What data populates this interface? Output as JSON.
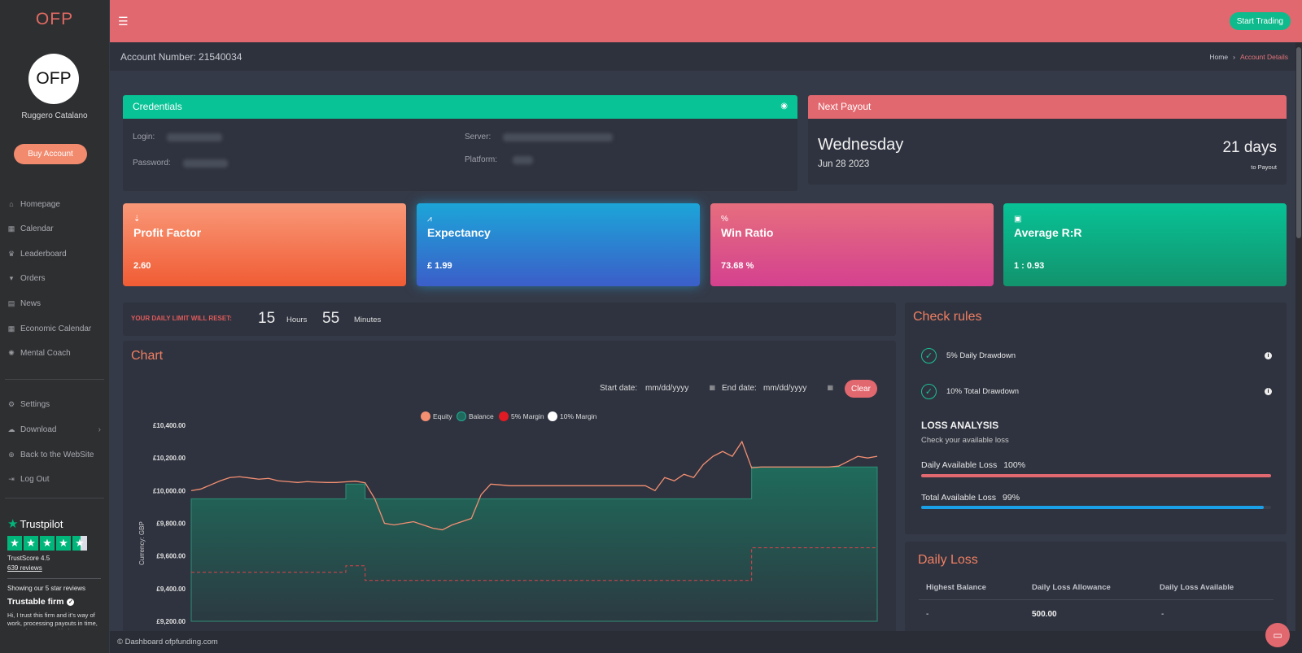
{
  "sidebar": {
    "logo": "OFP",
    "avatar_text": "OFP",
    "user_name": "Ruggero Catalano",
    "buy_label": "Buy Account",
    "items": [
      {
        "label": "Homepage",
        "icon": "home-icon"
      },
      {
        "label": "Calendar",
        "icon": "calendar-icon"
      },
      {
        "label": "Leaderboard",
        "icon": "trophy-icon"
      },
      {
        "label": "Orders",
        "icon": "cart-icon"
      },
      {
        "label": "News",
        "icon": "news-icon"
      },
      {
        "label": "Economic Calendar",
        "icon": "calendar-icon"
      },
      {
        "label": "Mental Coach",
        "icon": "brain-icon"
      }
    ],
    "bottom_items": [
      {
        "label": "Settings",
        "icon": "user-cog-icon"
      },
      {
        "label": "Download",
        "icon": "cloud-download-icon"
      },
      {
        "label": "Back to the WebSite",
        "icon": "globe-icon"
      },
      {
        "label": "Log Out",
        "icon": "logout-icon"
      }
    ],
    "trustpilot": {
      "name": "Trustpilot",
      "score": "TrustScore 4.5",
      "reviews": "639 reviews",
      "showing": "Showing our 5 star reviews",
      "review_title": "Trustable firm",
      "review_text": "Hi, I trust this firm and it's way of work, processing payouts in time, server is great, and help"
    }
  },
  "topbar": {
    "start_label": "Start Trading"
  },
  "subbar": {
    "account": "Account Number: 21540034",
    "crumb_home": "Home",
    "crumb_current": "Account Details"
  },
  "credentials": {
    "title": "Credentials",
    "login_label": "Login:",
    "password_label": "Password:",
    "server_label": "Server:",
    "platform_label": "Platform:"
  },
  "payout": {
    "title": "Next Payout",
    "day": "Wednesday",
    "date": "Jun 28 2023",
    "days": "21 days",
    "to": "to Payout"
  },
  "stats": [
    {
      "title": "Profit Factor",
      "value": "2.60",
      "icon": "arrow-down-icon"
    },
    {
      "title": "Expectancy",
      "value": "£ 1.99",
      "icon": "chart-line-icon"
    },
    {
      "title": "Win Ratio",
      "value": "73.68 %",
      "icon": "percent-icon"
    },
    {
      "title": "Average R:R",
      "value": "1 : 0.93",
      "icon": "money-bill-icon"
    }
  ],
  "reset": {
    "label": "YOUR DAILY LIMIT WILL RESET:",
    "hours": "15",
    "hours_label": "Hours",
    "minutes": "55",
    "minutes_label": "Minutes"
  },
  "chart_section": {
    "title": "Chart",
    "start_label": "Start date:",
    "end_label": "End date:",
    "date_placeholder": "mm/dd/yyyy",
    "clear_label": "Clear"
  },
  "chart_data": {
    "type": "line",
    "ylabel": "Currency: GBP",
    "ylim": [
      9200,
      10400
    ],
    "ticks": [
      "£10,400.00",
      "£10,200.00",
      "£10,000.00",
      "£9,800.00",
      "£9,600.00",
      "£9,400.00",
      "£9,200.00"
    ],
    "tick_values": [
      10400,
      10200,
      10000,
      9800,
      9600,
      9400,
      9200
    ],
    "legend": [
      "Equity",
      "Balance",
      "5% Margin",
      "10% Margin"
    ],
    "colors": {
      "equity": "#f48f72",
      "balance": "#1f6a5c",
      "margin5": "#e01b24",
      "margin10": "#ffffff"
    },
    "series": [
      {
        "name": "Equity",
        "values": [
          10000,
          10010,
          10035,
          10060,
          10080,
          10085,
          10078,
          10070,
          10075,
          10060,
          10055,
          10050,
          10055,
          10052,
          10050,
          10050,
          10054,
          10058,
          10048,
          9950,
          9800,
          9790,
          9800,
          9810,
          9790,
          9770,
          9760,
          9790,
          9810,
          9830,
          9975,
          10040,
          10035,
          10030,
          10030,
          10030,
          10030,
          10030,
          10030,
          10030,
          10030,
          10030,
          10030,
          10030,
          10030,
          10030,
          10030,
          10030,
          10000,
          10080,
          10060,
          10100,
          10080,
          10160,
          10210,
          10240,
          10210,
          10300,
          10140,
          10145,
          10145,
          10145,
          10145,
          10145,
          10145,
          10145,
          10145,
          10150,
          10180,
          10210,
          10200,
          10210
        ]
      },
      {
        "name": "Balance",
        "values": [
          9950,
          9950,
          9950,
          9950,
          9950,
          9950,
          9950,
          9950,
          9950,
          9950,
          9950,
          9950,
          9950,
          9950,
          9950,
          9950,
          10040,
          10040,
          9950,
          9950,
          9950,
          9950,
          9950,
          9950,
          9950,
          9950,
          9950,
          9950,
          9950,
          9950,
          9950,
          9950,
          9950,
          9950,
          9950,
          9950,
          9950,
          9950,
          9950,
          9950,
          9950,
          9950,
          9950,
          9950,
          9950,
          9950,
          9950,
          9950,
          9950,
          9950,
          9950,
          9950,
          9950,
          9950,
          9950,
          9950,
          9950,
          9950,
          10145,
          10145,
          10145,
          10145,
          10145,
          10145,
          10145,
          10145,
          10145,
          10145,
          10145,
          10145,
          10145,
          10145
        ]
      }
    ],
    "margin5": [
      9500,
      9500,
      9500,
      9500,
      9500,
      9500,
      9500,
      9500,
      9500,
      9500,
      9500,
      9500,
      9500,
      9500,
      9500,
      9500,
      9540,
      9540,
      9450,
      9450,
      9450,
      9450,
      9450,
      9450,
      9450,
      9450,
      9450,
      9450,
      9450,
      9450,
      9450,
      9450,
      9450,
      9450,
      9450,
      9450,
      9450,
      9450,
      9450,
      9450,
      9450,
      9450,
      9450,
      9450,
      9450,
      9450,
      9450,
      9450,
      9450,
      9450,
      9450,
      9450,
      9450,
      9450,
      9450,
      9450,
      9450,
      9450,
      9650,
      9650,
      9650,
      9650,
      9650,
      9650,
      9650,
      9650,
      9650,
      9650,
      9650,
      9650,
      9650,
      9650
    ]
  },
  "rules": {
    "title": "Check rules",
    "items": [
      "5% Daily Drawdown",
      "10% Total Drawdown"
    ],
    "loss_title": "LOSS ANALYSIS",
    "loss_sub": "Check your available loss",
    "daily_label": "Daily Available Loss",
    "daily_pct": "100%",
    "daily_fill": 1.0,
    "total_label": "Total Available Loss",
    "total_pct": "99%",
    "total_fill": 0.99
  },
  "daily_loss": {
    "title": "Daily Loss",
    "headers": [
      "Highest Balance",
      "Daily Loss Allowance",
      "Daily Loss Available"
    ],
    "row": [
      "-",
      "500.00",
      "-"
    ]
  },
  "footer": {
    "text": "© Dashboard ofpfunding.com"
  }
}
